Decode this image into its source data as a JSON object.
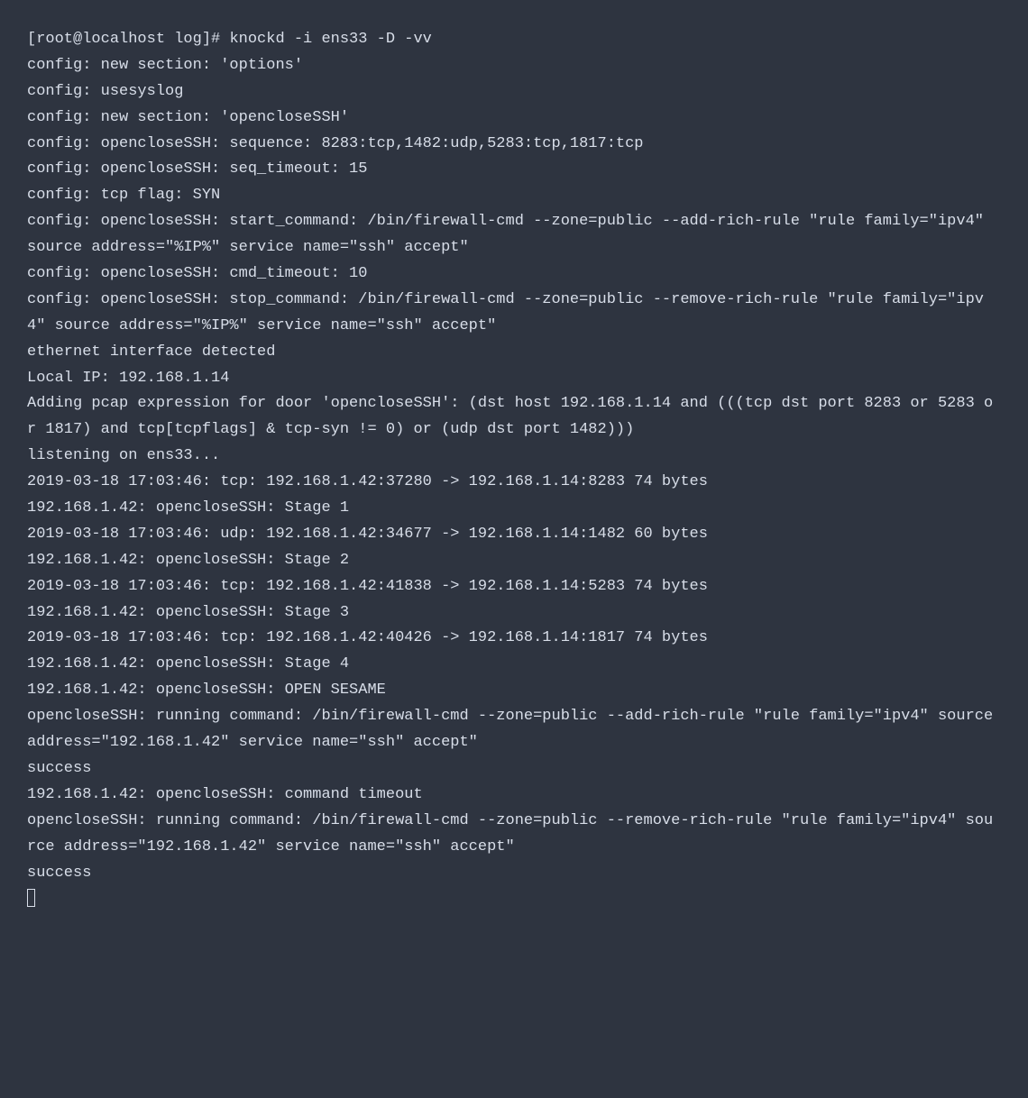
{
  "prompt": "[root@localhost log]# ",
  "command": "knockd -i ens33 -D -vv",
  "lines": [
    "config: new section: 'options'",
    "config: usesyslog",
    "config: new section: 'opencloseSSH'",
    "config: opencloseSSH: sequence: 8283:tcp,1482:udp,5283:tcp,1817:tcp",
    "config: opencloseSSH: seq_timeout: 15",
    "config: tcp flag: SYN",
    "config: opencloseSSH: start_command: /bin/firewall-cmd --zone=public --add-rich-rule \"rule family=\"ipv4\" source address=\"%IP%\" service name=\"ssh\" accept\"",
    "config: opencloseSSH: cmd_timeout: 10",
    "config: opencloseSSH: stop_command: /bin/firewall-cmd --zone=public --remove-rich-rule \"rule family=\"ipv4\" source address=\"%IP%\" service name=\"ssh\" accept\"",
    "ethernet interface detected",
    "Local IP: 192.168.1.14",
    "Adding pcap expression for door 'opencloseSSH': (dst host 192.168.1.14 and (((tcp dst port 8283 or 5283 or 1817) and tcp[tcpflags] & tcp-syn != 0) or (udp dst port 1482)))",
    "listening on ens33...",
    "2019-03-18 17:03:46: tcp: 192.168.1.42:37280 -> 192.168.1.14:8283 74 bytes",
    "192.168.1.42: opencloseSSH: Stage 1",
    "2019-03-18 17:03:46: udp: 192.168.1.42:34677 -> 192.168.1.14:1482 60 bytes",
    "192.168.1.42: opencloseSSH: Stage 2",
    "2019-03-18 17:03:46: tcp: 192.168.1.42:41838 -> 192.168.1.14:5283 74 bytes",
    "192.168.1.42: opencloseSSH: Stage 3",
    "2019-03-18 17:03:46: tcp: 192.168.1.42:40426 -> 192.168.1.14:1817 74 bytes",
    "192.168.1.42: opencloseSSH: Stage 4",
    "192.168.1.42: opencloseSSH: OPEN SESAME",
    "opencloseSSH: running command: /bin/firewall-cmd --zone=public --add-rich-rule \"rule family=\"ipv4\" source address=\"192.168.1.42\" service name=\"ssh\" accept\"",
    "success",
    "192.168.1.42: opencloseSSH: command timeout",
    "opencloseSSH: running command: /bin/firewall-cmd --zone=public --remove-rich-rule \"rule family=\"ipv4\" source address=\"192.168.1.42\" service name=\"ssh\" accept\"",
    "success"
  ]
}
